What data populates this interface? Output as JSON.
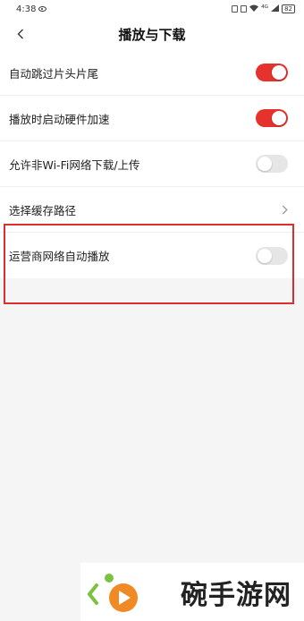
{
  "status_bar": {
    "time": "4:38",
    "signal": "⁴ᴳ",
    "battery": "82"
  },
  "header": {
    "title": "播放与下载"
  },
  "settings": [
    {
      "label": "自动跳过片头片尾",
      "control": "toggle",
      "on": true
    },
    {
      "label": "播放时启动硬件加速",
      "control": "toggle",
      "on": true
    },
    {
      "label": "允许非Wi-Fi网络下载/上传",
      "control": "toggle",
      "on": false
    },
    {
      "label": "选择缓存路径",
      "control": "chevron"
    },
    {
      "label": "运营商网络自动播放",
      "control": "toggle",
      "on": false
    }
  ],
  "watermark": {
    "text": "碗手游网"
  },
  "colors": {
    "accent": "#e5322d",
    "highlight_border": "#d92f2f",
    "toggle_off": "#e6e6e6",
    "page_background": "#f5f5f5"
  },
  "icons": {
    "back": "chevron-left-icon",
    "path": "chevron-right-icon"
  }
}
